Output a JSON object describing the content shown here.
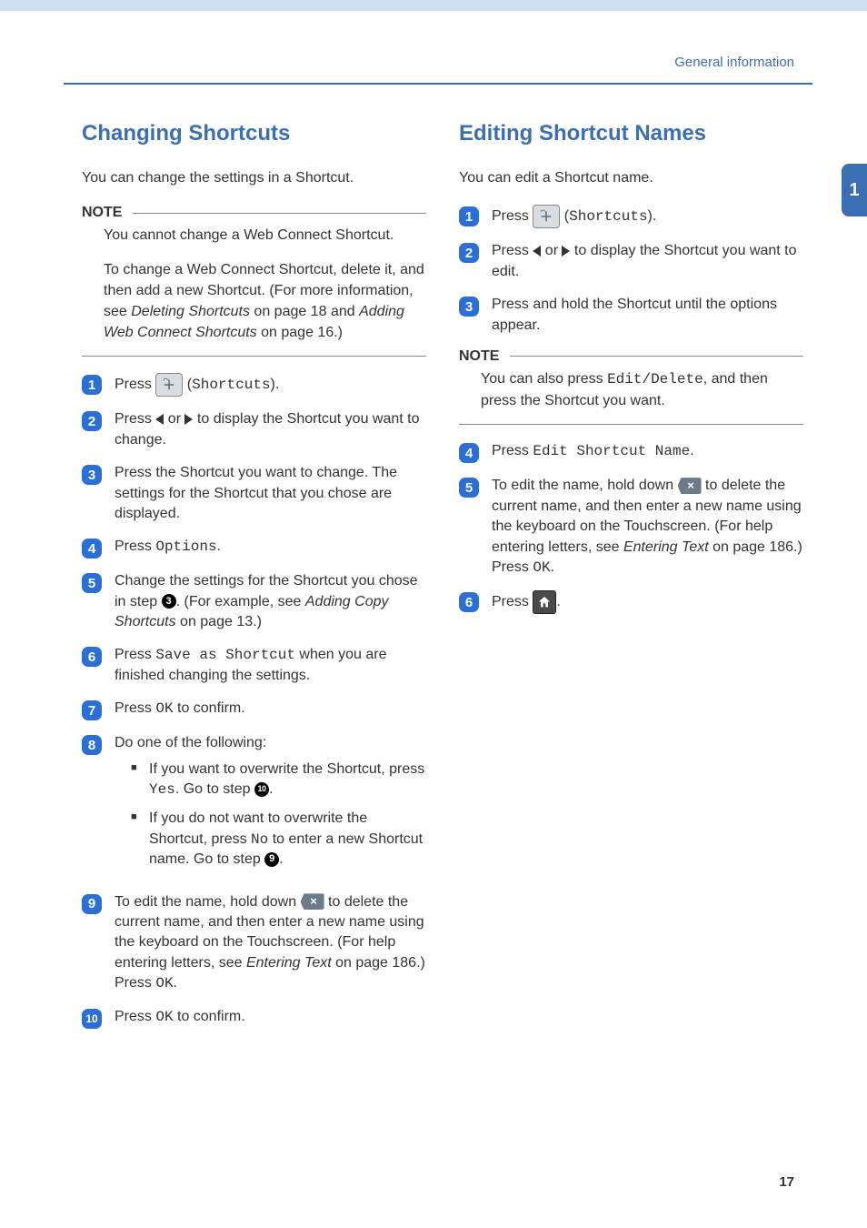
{
  "header": {
    "label": "General information"
  },
  "sideTab": "1",
  "pageNumber": "17",
  "left": {
    "title": "Changing Shortcuts",
    "intro": "You can change the settings in a Shortcut.",
    "noteTitle": "NOTE",
    "note1": "You cannot change a Web Connect Shortcut.",
    "note2a": "To change a Web Connect Shortcut, delete it, and then add a new Shortcut. (For more information, see ",
    "note2b": "Deleting Shortcuts",
    "note2c": " on page 18 and ",
    "note2d": "Adding Web Connect Shortcuts",
    "note2e": " on page 16.)",
    "step1a": "Press ",
    "step1b": " (",
    "step1c": "Shortcuts",
    "step1d": ").",
    "step2a": "Press ",
    "step2b": " or ",
    "step2c": " to display the Shortcut you want to change.",
    "step3": "Press the Shortcut you want to change. The settings for the Shortcut that you chose are displayed.",
    "step4a": "Press ",
    "step4b": "Options",
    "step4c": ".",
    "step5a": "Change the settings for the Shortcut you chose in step ",
    "step5ref": "3",
    "step5b": ". (For example, see ",
    "step5c": "Adding Copy Shortcuts",
    "step5d": " on page 13.)",
    "step6a": "Press ",
    "step6b": "Save as Shortcut",
    "step6c": " when you are finished changing the settings.",
    "step7a": "Press ",
    "step7b": "OK",
    "step7c": " to confirm.",
    "step8": "Do one of the following:",
    "step8_b1a": "If you want to overwrite the Shortcut, press ",
    "step8_b1b": "Yes",
    "step8_b1c": ". Go to step ",
    "step8_b1ref": "10",
    "step8_b1d": ".",
    "step8_b2a": "If you do not want to overwrite the Shortcut, press ",
    "step8_b2b": "No",
    "step8_b2c": " to enter a new Shortcut name. Go to step ",
    "step8_b2ref": "9",
    "step8_b2d": ".",
    "step9a": "To edit the name, hold down ",
    "step9b": " to delete the current name, and then enter a new name using the keyboard on the Touchscreen. (For help entering letters, see ",
    "step9c": "Entering Text",
    "step9d": " on page 186.) Press ",
    "step9e": "OK",
    "step9f": ".",
    "step10a": "Press ",
    "step10b": "OK",
    "step10c": " to confirm."
  },
  "right": {
    "title": "Editing Shortcut Names",
    "intro": "You can edit a Shortcut name.",
    "step1a": "Press ",
    "step1b": " (",
    "step1c": "Shortcuts",
    "step1d": ").",
    "step2a": "Press ",
    "step2b": " or ",
    "step2c": " to display the Shortcut you want to edit.",
    "step3": "Press and hold the Shortcut until the options appear.",
    "noteTitle": "NOTE",
    "note1a": "You can also press ",
    "note1b": "Edit/Delete",
    "note1c": ", and then press the Shortcut you want.",
    "step4a": "Press ",
    "step4b": "Edit Shortcut Name",
    "step4c": ".",
    "step5a": "To edit the name, hold down ",
    "step5b": " to delete the current name, and then enter a new name using the keyboard on the Touchscreen. (For help entering letters, see ",
    "step5c": "Entering Text",
    "step5d": " on page 186.) Press ",
    "step5e": "OK",
    "step5f": ".",
    "step6a": "Press ",
    "step6b": "."
  }
}
